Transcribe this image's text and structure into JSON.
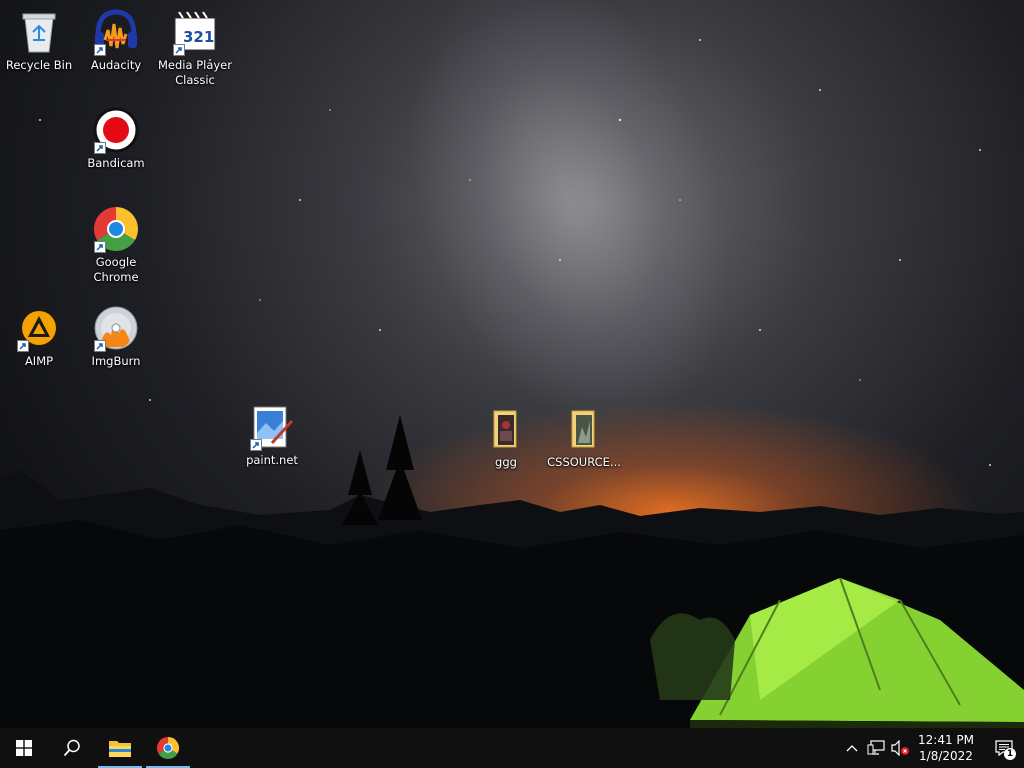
{
  "desktop": {
    "icons": [
      {
        "label": "Recycle Bin",
        "icon": "recycle-bin-icon"
      },
      {
        "label": "Audacity",
        "icon": "audacity-icon"
      },
      {
        "label": "Media Player Classic",
        "icon": "media-player-classic-icon",
        "badge": "321"
      },
      {
        "label": "Bandicam",
        "icon": "bandicam-icon"
      },
      {
        "label": "Google Chrome",
        "icon": "chrome-icon"
      },
      {
        "label": "AIMP",
        "icon": "aimp-icon"
      },
      {
        "label": "ImgBurn",
        "icon": "imgburn-icon"
      },
      {
        "label": "paint.net",
        "icon": "paintnet-icon"
      },
      {
        "label": "ggg",
        "icon": "folder-icon"
      },
      {
        "label": "CSSOURCE...",
        "icon": "folder-icon"
      }
    ]
  },
  "taskbar": {
    "start": "windows-start-icon",
    "search": "search-icon",
    "pinned": [
      {
        "name": "file-explorer",
        "icon": "folder-icon"
      },
      {
        "name": "google-chrome",
        "icon": "chrome-icon"
      }
    ],
    "tray": {
      "icons": [
        "chevron-up-icon",
        "network-icon",
        "volume-muted-icon"
      ],
      "time": "12:41 PM",
      "date": "1/8/2022",
      "notifications": "1"
    }
  },
  "colors": {
    "taskbar_bg": "#101010",
    "active_indicator": "#76b9ed",
    "tent_green": "#9be53a"
  }
}
